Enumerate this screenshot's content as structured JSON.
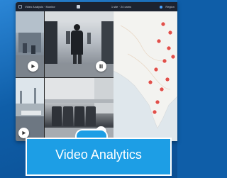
{
  "app": {
    "toolbar_left": "Video Analysis · Monitor",
    "toolbar_center": "1 site · 24 cams",
    "toolbar_right": "Region"
  },
  "videos": [
    {
      "name": "video-tile-1",
      "control": "play-icon"
    },
    {
      "name": "video-tile-2",
      "control": "pause-icon"
    },
    {
      "name": "video-tile-3",
      "control": "play-icon"
    },
    {
      "name": "video-tile-4",
      "control": "play-icon"
    }
  ],
  "map": {
    "land_color": "#f3f3f0",
    "water_color": "#dfe7ec",
    "marker_color": "#e0504a"
  },
  "badge": {
    "label": "Video Analytics",
    "color": "#1d9ee5"
  }
}
